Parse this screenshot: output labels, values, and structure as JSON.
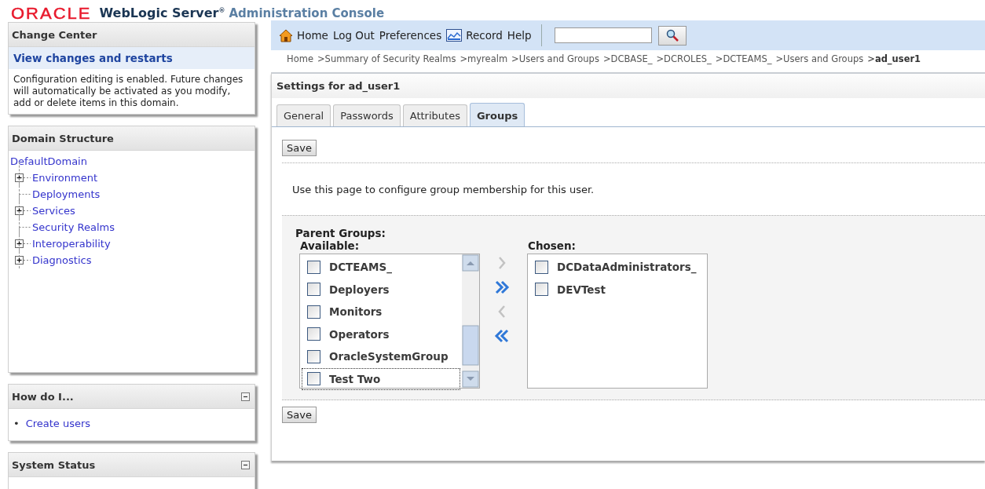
{
  "header": {
    "logo": "ORACLE",
    "product": "WebLogic Server$^{®}$",
    "subtitle": "Administration Console"
  },
  "change_center": {
    "title": "Change Center",
    "link": "View changes and restarts",
    "message": "Configuration editing is enabled. Future changes will automatically be activated as you modify, add or delete items in this domain."
  },
  "domain_structure": {
    "title": "Domain Structure",
    "tree": {
      "label": "DefaultDomain",
      "children": [
        {
          "label": "Environment",
          "expandable": true
        },
        {
          "label": "Deployments",
          "expandable": false
        },
        {
          "label": "Services",
          "expandable": true
        },
        {
          "label": "Security Realms",
          "expandable": false
        },
        {
          "label": "Interoperability",
          "expandable": true
        },
        {
          "label": "Diagnostics",
          "expandable": true
        }
      ]
    }
  },
  "how_do_i": {
    "title": "How do I...",
    "collapsible": true,
    "links": [
      {
        "bullet": "•",
        "text": "Create users"
      }
    ]
  },
  "system_status": {
    "title": "System Status",
    "collapsible": true
  },
  "toolbar": {
    "items": [
      {
        "label": "Home",
        "kind": "home"
      },
      {
        "label": "Log Out",
        "kind": "plain"
      },
      {
        "label": "Preferences",
        "kind": "plain"
      },
      {
        "label": "Record",
        "kind": "record"
      },
      {
        "label": "Help",
        "kind": "plain"
      }
    ]
  },
  "breadcrumb": [
    {
      "text": "Home"
    },
    {
      "text": ">Summary of Security Realms"
    },
    {
      "text": ">myrealm"
    },
    {
      "text": ">Users and Groups"
    },
    {
      "text": ">DCBASE_"
    },
    {
      "text": ">DCROLES_"
    },
    {
      "text": ">DCTEAMS_"
    },
    {
      "text": ">Users and Groups"
    },
    {
      "text": ">**ad_user1**",
      "current": true
    }
  ],
  "settings": {
    "title": "Settings for ad_user1",
    "tabs": [
      {
        "label": "General",
        "selected": false
      },
      {
        "label": "Passwords",
        "selected": false
      },
      {
        "label": "Attributes",
        "selected": false
      },
      {
        "label": "Groups",
        "selected": true
      }
    ],
    "top_save": "Save",
    "intro": "Use this page to configure group membership for this user.",
    "parent_groups": {
      "heading": "Parent Groups:",
      "available": {
        "label": "Available:",
        "items": [
          {
            "name": "DCTEAMS_",
            "checked": false,
            "focused": false
          },
          {
            "name": "Deployers",
            "checked": false,
            "focused": false
          },
          {
            "name": "Monitors",
            "checked": false,
            "focused": false
          },
          {
            "name": "Operators",
            "checked": false,
            "focused": false
          },
          {
            "name": "OracleSystemGroup",
            "checked": false,
            "focused": false
          },
          {
            "name": "Test Two",
            "checked": false,
            "focused": true
          }
        ]
      },
      "move_buttons": [
        {
          "kind": "add",
          "disabled": true
        },
        {
          "kind": "add-all",
          "disabled": false
        },
        {
          "kind": "remove",
          "disabled": true
        },
        {
          "kind": "remove-all",
          "disabled": false
        }
      ],
      "chosen": {
        "label": "Chosen:",
        "items": [
          {
            "name": "DCDataAdministrators_",
            "checked": false,
            "focused": false
          },
          {
            "name": "DEVTest",
            "checked": false,
            "focused": false
          }
        ]
      }
    },
    "bottom_save": "Save"
  }
}
